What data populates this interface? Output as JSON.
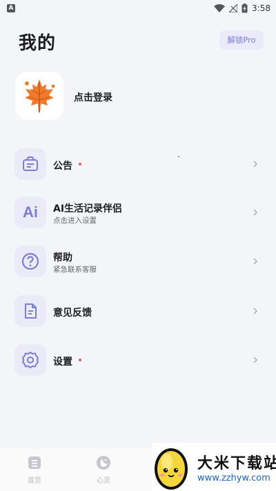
{
  "status_bar": {
    "time": "3:58",
    "icons": [
      "app-a-icon",
      "wifi-icon",
      "signal-off-icon",
      "battery-charging-icon"
    ]
  },
  "header": {
    "title": "我的",
    "unlock_label": "解锁Pro"
  },
  "profile": {
    "login_label": "点击登录",
    "avatar_icon": "maple-leaf-icon"
  },
  "menu": {
    "items": [
      {
        "icon": "announcement-icon",
        "title": "公告",
        "subtitle": "",
        "badge": true
      },
      {
        "icon": "ai-icon",
        "title": "AI生活记录伴侣",
        "subtitle": "点击进入设置",
        "badge": false,
        "icon_text": "Ai"
      },
      {
        "icon": "help-icon",
        "title": "帮助",
        "subtitle": "紧急联系客服",
        "badge": false
      },
      {
        "icon": "feedback-icon",
        "title": "意见反馈",
        "subtitle": "",
        "badge": false
      },
      {
        "icon": "settings-icon",
        "title": "设置",
        "subtitle": "",
        "badge": true
      }
    ]
  },
  "bottom_nav": {
    "tabs": [
      {
        "label": "首页",
        "icon": "home-doc-icon"
      },
      {
        "label": "心灵",
        "icon": "moon-star-icon"
      }
    ]
  },
  "watermark": {
    "title": "大米下载站",
    "url": "www.zzhyw.com"
  },
  "colors": {
    "accent": "#7a7fd4",
    "icon_bg": "#ebebf8",
    "badge": "#e85b5b",
    "background": "#f4f5f8"
  }
}
